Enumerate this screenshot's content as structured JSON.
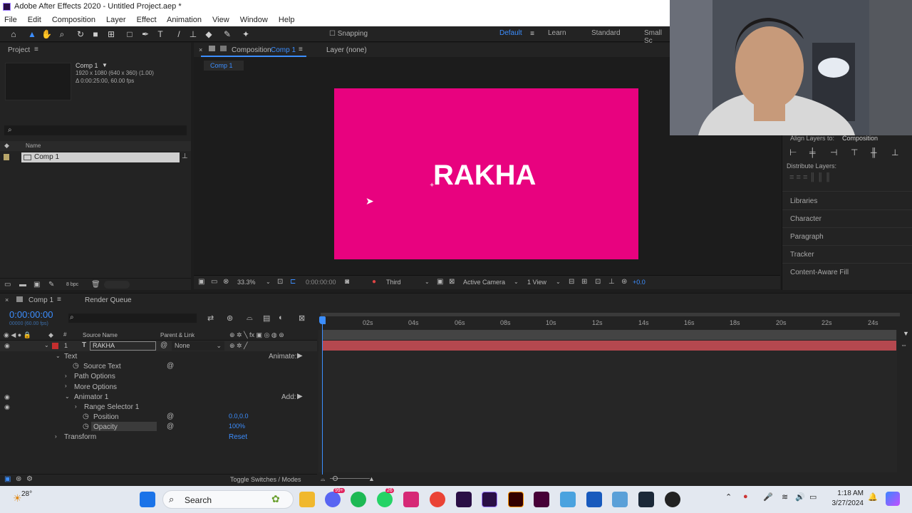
{
  "window": {
    "title": "Adobe After Effects 2020 - Untitled Project.aep *"
  },
  "menu": [
    "File",
    "Edit",
    "Composition",
    "Layer",
    "Effect",
    "Animation",
    "View",
    "Window",
    "Help"
  ],
  "toolbar": {
    "snapping": "Snapping",
    "workspaces": [
      "Default",
      "Learn",
      "Standard",
      "Small Sc"
    ]
  },
  "project": {
    "title": "Project",
    "comp_name": "Comp 1",
    "comp_res": "1920 x 1080  (640 x 360) (1.00)",
    "comp_dur": "Δ 0:00:25:00, 60.00 fps",
    "search_placeholder": "",
    "col_name": "Name",
    "item": "Comp 1",
    "bpc": "8 bpc"
  },
  "composition": {
    "tab_prefix": "Composition",
    "tab_name": "Comp 1",
    "layer_tab": "Layer  (none)",
    "breadcrumb": "Comp 1",
    "canvas_text": "RAKHA",
    "canvas_color": "#e8027f",
    "zoom": "33.3%",
    "timecode": "0:00:00:00",
    "resolution": "Third",
    "camera": "Active Camera",
    "views": "1 View",
    "exposure": "+0.0"
  },
  "right_panel": {
    "align_to_label": "Align Layers to:",
    "align_to_value": "Composition",
    "distribute": "Distribute Layers:",
    "items": [
      "Libraries",
      "Character",
      "Paragraph",
      "Tracker",
      "Content-Aware Fill"
    ]
  },
  "timeline": {
    "tab": "Comp 1",
    "render_queue": "Render Queue",
    "time": "0:00:00:00",
    "time_sub": "00000 (60.00 fps)",
    "col_source": "Source Name",
    "col_parent": "Parent & Link",
    "layer_num": "1",
    "layer_name": "RAKHA",
    "parent": "None",
    "props": {
      "text": "Text",
      "animate": "Animate:",
      "source_text": "Source Text",
      "path_options": "Path Options",
      "more_options": "More Options",
      "animator": "Animator 1",
      "add": "Add:",
      "range_selector": "Range Selector 1",
      "position": "Position",
      "position_val": "0.0,0.0",
      "opacity": "Opacity",
      "opacity_val": "100%",
      "transform": "Transform",
      "reset": "Reset"
    },
    "ruler": [
      "02s",
      "04s",
      "06s",
      "08s",
      "10s",
      "12s",
      "14s",
      "16s",
      "18s",
      "20s",
      "22s",
      "24s"
    ],
    "toggle": "Toggle Switches / Modes"
  },
  "taskbar": {
    "weather": "28°",
    "search": "Search",
    "time": "1:18 AM",
    "date": "3/27/2024",
    "badges": [
      "99+",
      "26"
    ]
  }
}
